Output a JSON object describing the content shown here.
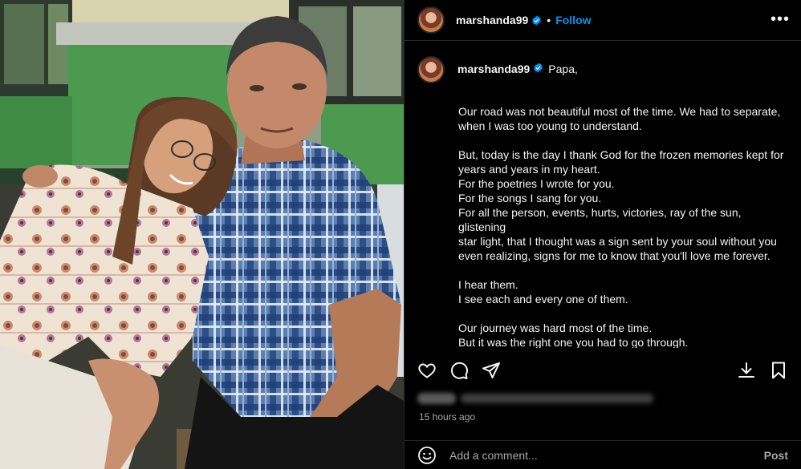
{
  "post": {
    "username": "marshanda99",
    "follow_label": "Follow",
    "separator": "•",
    "more_label": "•••",
    "caption_first": "Papa,",
    "caption_body": "\nOur road was not beautiful most of the time. We had to separate,\nwhen I was too young to understand.\n\nBut, today is the day I thank God for the frozen memories kept for\nyears and years in my heart.\nFor the poetries I wrote for you.\nFor the songs I sang for you.\nFor all the person, events, hurts, victories, ray of the sun, glistening\nstar light, that I thought was a sign sent by your soul without you\neven realizing, signs for me to know that you'll love me forever.\n\nI hear them.\nI see each and every one of them.\n\nOur journey was hard most of the time.\nBut it was the right one you had to go through.\nIt was the perfect one for me to grow in.\nI don't regret a thing.",
    "timestamp": "15 hours ago",
    "comment_placeholder": "Add a comment...",
    "post_label": "Post"
  },
  "icons": {
    "verified": "verified-badge-icon",
    "like": "heart-icon",
    "comment": "comment-icon",
    "share": "paper-plane-icon",
    "save": "bookmark-icon",
    "download": "download-icon",
    "emoji": "smiley-icon",
    "more": "more-options-icon"
  },
  "colors": {
    "background": "#000000",
    "accent": "#0095f6",
    "text": "#f5f5f5",
    "muted": "#a8a8a8",
    "divider": "#262626"
  }
}
